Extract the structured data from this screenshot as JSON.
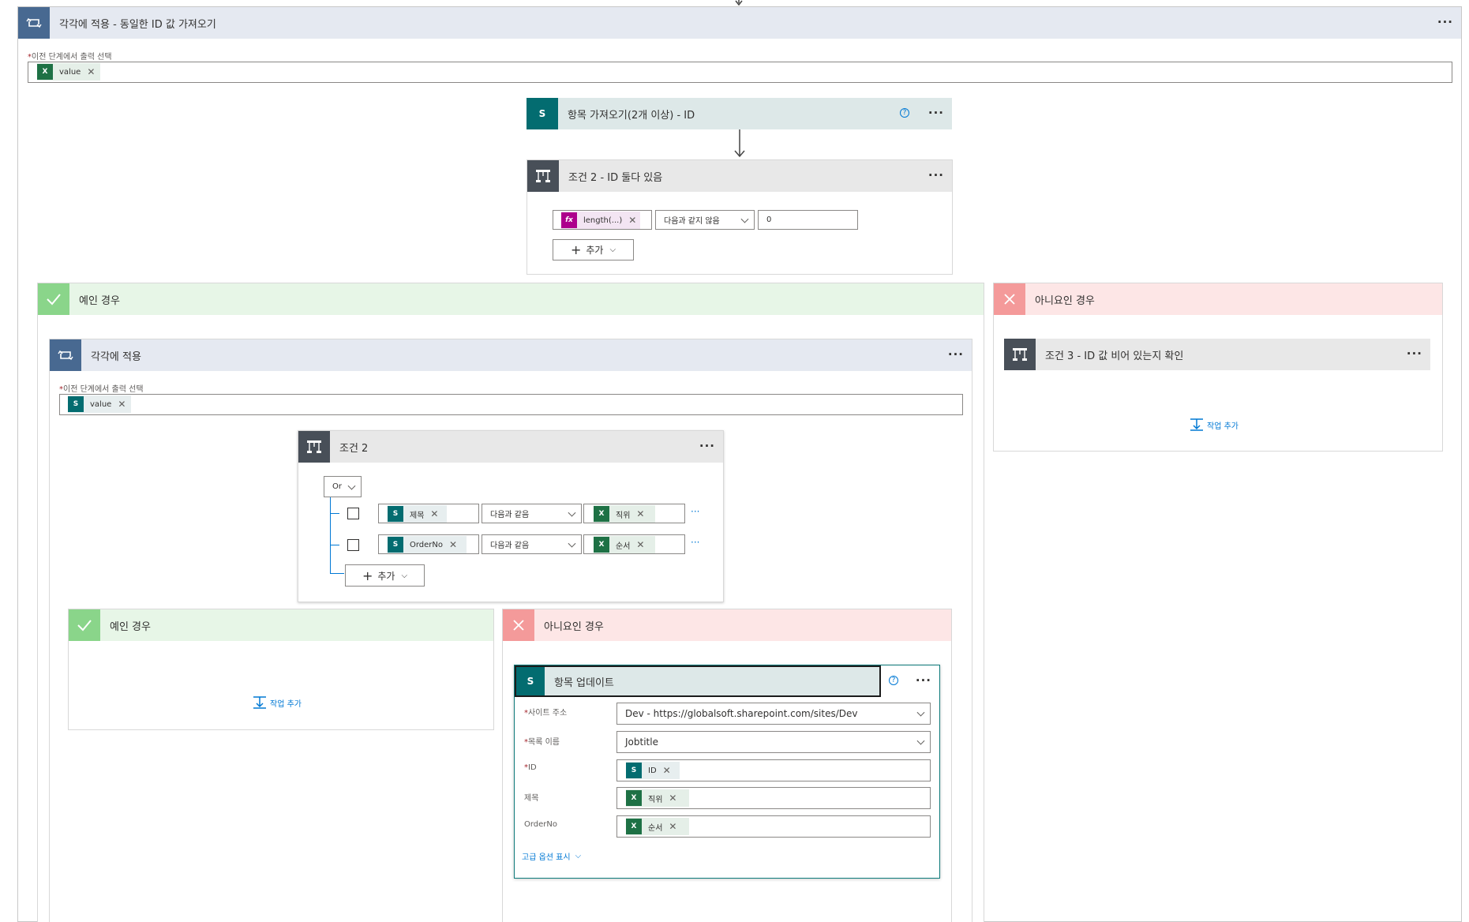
{
  "outer_loop": {
    "title": "각각에 적용 - 동일한 ID 값 가져오기",
    "field_label": "이전 단계에서 출력 선택",
    "token": "value"
  },
  "get_items": {
    "title": "항목 가져오기(2개 이상) - ID",
    "help": "?"
  },
  "cond2_top": {
    "title": "조건 2 - ID 둘다 있음",
    "token": "length(...)",
    "operator": "다음과 같지 않음",
    "value": "0",
    "add_label": "추가"
  },
  "yes_branch": {
    "title": "예인 경우"
  },
  "no_branch": {
    "title": "아니요인 경우"
  },
  "cond3": {
    "title": "조건 3 - ID 값 비어 있는지 확인",
    "add_action": "작업 추가"
  },
  "inner_loop": {
    "title": "각각에 적용",
    "field_label": "이전 단계에서 출력 선택",
    "token": "value"
  },
  "cond2_inner": {
    "title": "조건 2",
    "group_op": "Or",
    "rows": [
      {
        "left": "제목",
        "operator": "다음과 같음",
        "right": "직위"
      },
      {
        "left": "OrderNo",
        "operator": "다음과 같음",
        "right": "순서"
      }
    ],
    "add_label": "추가"
  },
  "inner_yes": {
    "title": "예인 경우",
    "add_action": "작업 추가"
  },
  "inner_no": {
    "title": "아니요인 경우"
  },
  "update_item": {
    "title": "항목 업데이트",
    "help": "?",
    "site_label": "사이트 주소",
    "site_value": "Dev - https://globalsoft.sharepoint.com/sites/Dev",
    "list_label": "목록 이름",
    "list_value": "Jobtitle",
    "id_label": "ID",
    "id_token": "ID",
    "title_label": "제목",
    "title_token": "직위",
    "orderno_label": "OrderNo",
    "orderno_token": "순서",
    "advanced": "고급 옵션 표시"
  },
  "more": "···",
  "icons": {
    "loop": "loop-icon",
    "sharepoint": "sharepoint-icon",
    "condition": "condition-icon",
    "check": "check-icon",
    "close": "close-icon",
    "excel": "excel-icon",
    "function": "fx-icon"
  },
  "colors": {
    "loop": "#486991",
    "sharepoint": "#036c70",
    "condition": "#484f58",
    "yes": "#8ad58a",
    "no": "#f49a9a",
    "accent": "#0078d4"
  }
}
